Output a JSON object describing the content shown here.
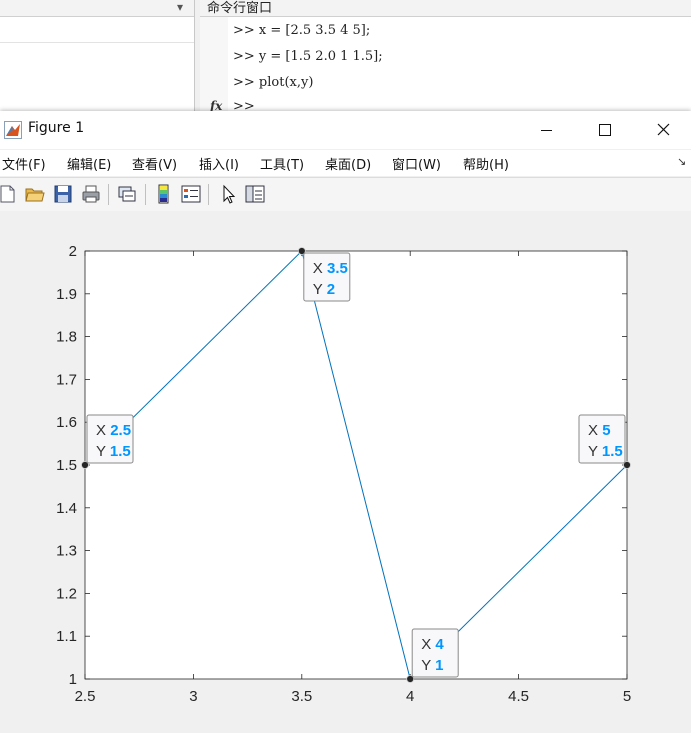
{
  "command_window": {
    "title": "命令行窗口",
    "lines": [
      ">> x = [2.5 3.5 4 5];",
      ">> y = [1.5 2.0 1 1.5];",
      ">> plot(x,y)",
      ">> "
    ],
    "fx_label": "fx"
  },
  "figure": {
    "title": "Figure 1",
    "menu": [
      "文件(F)",
      "编辑(E)",
      "查看(V)",
      "插入(I)",
      "工具(T)",
      "桌面(D)",
      "窗口(W)",
      "帮助(H)"
    ],
    "toolbar_icons": [
      "new-figure-icon",
      "open-folder-icon",
      "save-icon",
      "print-icon",
      "link-plot-icon",
      "colorbar-icon",
      "legend-icon",
      "pointer-icon",
      "property-inspector-icon"
    ]
  },
  "chart_data": {
    "type": "line",
    "x": [
      2.5,
      3.5,
      4,
      5
    ],
    "y": [
      1.5,
      2.0,
      1,
      1.5
    ],
    "xlim": [
      2.5,
      5
    ],
    "ylim": [
      1,
      2
    ],
    "xticks": [
      "2.5",
      "3",
      "3.5",
      "4",
      "4.5",
      "5"
    ],
    "yticks": [
      "1",
      "1.1",
      "1.2",
      "1.3",
      "1.4",
      "1.5",
      "1.6",
      "1.7",
      "1.8",
      "1.9",
      "2"
    ],
    "xlabel": "",
    "ylabel": "",
    "title": "",
    "grid": false,
    "line_color": "#0072bd",
    "datatips": [
      {
        "x_label": "X",
        "y_label": "Y",
        "x": "2.5",
        "y": "1.5",
        "placement": "above-right"
      },
      {
        "x_label": "X",
        "y_label": "Y",
        "x": "3.5",
        "y": "2",
        "placement": "below-right"
      },
      {
        "x_label": "X",
        "y_label": "Y",
        "x": "4",
        "y": "1",
        "placement": "above-right"
      },
      {
        "x_label": "X",
        "y_label": "Y",
        "x": "5",
        "y": "1.5",
        "placement": "above-left"
      }
    ],
    "datatip_value_color": "#0096ff"
  }
}
